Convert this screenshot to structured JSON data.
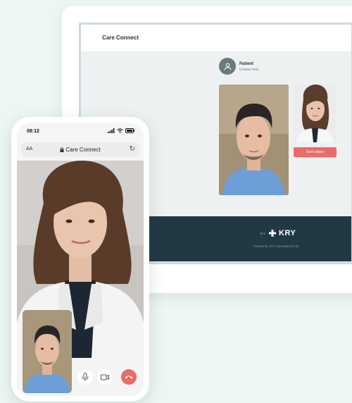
{
  "desktop": {
    "app_title": "Care Connect",
    "patient": {
      "name": "Patient",
      "phone": "07360674284"
    },
    "end_video_label": "End video",
    "footer": {
      "by": "BY",
      "brand": "KRY",
      "owned": "Owned by KRY International AB"
    }
  },
  "phone": {
    "time": "08:12",
    "aa": "AA",
    "url": "Care Connect",
    "controls": {
      "mic_label": "Mic",
      "camera_label": "Video"
    }
  },
  "colors": {
    "accent_red": "#ea6b68",
    "footer_navy": "#213942",
    "background": "#eef6f4"
  }
}
